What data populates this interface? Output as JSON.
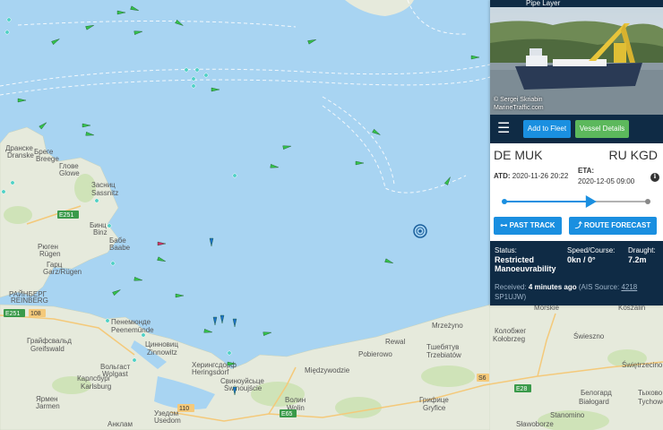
{
  "map": {
    "places": [
      {
        "id": "dranske",
        "text": "Дранске"
      },
      {
        "id": "dranske_en",
        "text": "Dranske"
      },
      {
        "id": "breege",
        "text": "Бреге"
      },
      {
        "id": "breege_en",
        "text": "Breege"
      },
      {
        "id": "glowe",
        "text": "Глове"
      },
      {
        "id": "glowe_en",
        "text": "Glowe"
      },
      {
        "id": "sassnitz",
        "text": "Засниц"
      },
      {
        "id": "sassnitz_en",
        "text": "Sassnitz"
      },
      {
        "id": "binz",
        "text": "Бинц"
      },
      {
        "id": "binz_en",
        "text": "Binz"
      },
      {
        "id": "baabe",
        "text": "Бабе"
      },
      {
        "id": "baabe_en",
        "text": "Baabe"
      },
      {
        "id": "rugen",
        "text": "Рюген"
      },
      {
        "id": "rugen_en",
        "text": "Rügen"
      },
      {
        "id": "garz",
        "text": "Гарц"
      },
      {
        "id": "garz_en",
        "text": "Garz/Rügen"
      },
      {
        "id": "reinberg",
        "text": "РАЙНБЕРГ"
      },
      {
        "id": "reinberg_en",
        "text": "REINBERG"
      },
      {
        "id": "greifswald",
        "text": "Грайфсвальд"
      },
      {
        "id": "greifswald_en",
        "text": "Greifswald"
      },
      {
        "id": "peenemunde",
        "text": "Пенемюнде"
      },
      {
        "id": "peenemunde_en",
        "text": "Peenemünde"
      },
      {
        "id": "zinnowitz",
        "text": "Цинновиц"
      },
      {
        "id": "zinnowitz_en",
        "text": "Zinnowitz"
      },
      {
        "id": "wolgast",
        "text": "Вольгаст"
      },
      {
        "id": "wolgast_en",
        "text": "Wolgast"
      },
      {
        "id": "karlsburg",
        "text": "Карлсбург"
      },
      {
        "id": "karlsburg_en",
        "text": "Karlsburg"
      },
      {
        "id": "jarmen",
        "text": "Ярмен"
      },
      {
        "id": "jarmen_en",
        "text": "Jarmen"
      },
      {
        "id": "heringsdorf",
        "text": "Херингсдорф"
      },
      {
        "id": "heringsdorf_en",
        "text": "Heringsdorf"
      },
      {
        "id": "swinoujscie",
        "text": "Свиноуйсьце"
      },
      {
        "id": "swinoujscie_en",
        "text": "Świnoujście"
      },
      {
        "id": "usedom",
        "text": "Узедом"
      },
      {
        "id": "usedom_en",
        "text": "Usedom"
      },
      {
        "id": "anklam",
        "text": "Анклам"
      },
      {
        "id": "wolin",
        "text": "Волин"
      },
      {
        "id": "wolin_en",
        "text": "Wolin"
      },
      {
        "id": "mrzezyno",
        "text": "Mrzeżyno"
      },
      {
        "id": "pobierowo",
        "text": "Pobierowo"
      },
      {
        "id": "rewal",
        "text": "Rewal"
      },
      {
        "id": "trzebiatow",
        "text": "Тшебятув"
      },
      {
        "id": "trzebiatow_en",
        "text": "Trzebiatów"
      },
      {
        "id": "gryfice",
        "text": "Грифице"
      },
      {
        "id": "gryfice_en",
        "text": "Gryfice"
      },
      {
        "id": "miedzywodzie",
        "text": "Międzywodzie"
      },
      {
        "id": "kolobrzeg",
        "text": "Колобжег"
      },
      {
        "id": "kolobrzeg_en",
        "text": "Kołobrzeg"
      },
      {
        "id": "morskie",
        "text": "Morskie"
      },
      {
        "id": "koszalin",
        "text": "Koszalin"
      },
      {
        "id": "bialogard",
        "text": "Белогард"
      },
      {
        "id": "bialogard_en",
        "text": "Białogard"
      },
      {
        "id": "tychowo",
        "text": "Тыхово"
      },
      {
        "id": "tychowo_en",
        "text": "Tychowo"
      },
      {
        "id": "stanomino",
        "text": "Stanomino"
      },
      {
        "id": "slawoborze",
        "text": "Sławoborze"
      },
      {
        "id": "swierzno",
        "text": "Świeszno"
      },
      {
        "id": "swietrzecino",
        "text": "Świętrzecino"
      }
    ],
    "roads": [
      {
        "id": "e251a",
        "text": "E251"
      },
      {
        "id": "e251b",
        "text": "E251"
      },
      {
        "id": "r108",
        "text": "108"
      },
      {
        "id": "r110",
        "text": "110"
      },
      {
        "id": "e65",
        "text": "E65"
      },
      {
        "id": "s6",
        "text": "S6"
      },
      {
        "id": "e28",
        "text": "E28"
      }
    ]
  },
  "vessel": {
    "type": "Pipe Layer",
    "photo_credit": "© Sergei Skriabin",
    "photo_site": "MarineTraffic.com"
  },
  "toolbar": {
    "menu_icon": "☰",
    "add_fleet_label": "Add to Fleet",
    "vessel_details_label": "Vessel Details"
  },
  "voyage": {
    "from_country": "DE",
    "from_port": "MUK",
    "to_country": "RU",
    "to_port": "KGD",
    "atd_label": "ATD:",
    "atd_value": "2020-11-26 20:22",
    "eta_label": "ETA:",
    "eta_value": "2020-12-05 09:00",
    "info_icon": "ℹ",
    "progress": 0.58,
    "past_track_label": "PAST TRACK",
    "route_forecast_label": "ROUTE FORECAST"
  },
  "status": {
    "status_label": "Status:",
    "status_value": "Restricted Manoeuvrability",
    "speed_label": "Speed/Course:",
    "speed_value": "0kn / 0°",
    "draught_label": "Draught:",
    "draught_value": "7.2m",
    "received_prefix": "Received:",
    "received_value": "4 minutes ago",
    "ais_prefix": "(AIS Source:",
    "ais_id": "4218",
    "ais_station": "SP1UJW",
    "ais_suffix": ")"
  },
  "colors": {
    "sea": "#a8d4f2",
    "land": "#e6eadc",
    "panel_dark": "#0f2b45",
    "accent_blue": "#1a8fe0",
    "accent_green": "#5cb85c"
  }
}
